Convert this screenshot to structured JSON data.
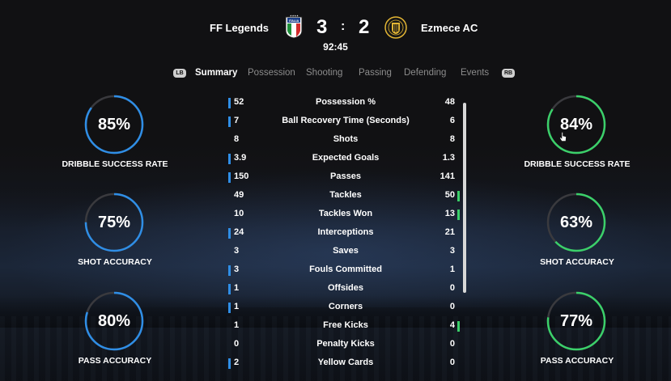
{
  "header": {
    "home_team": "FF Legends",
    "away_team": "Ezmece AC",
    "home_score": "3",
    "separator": ":",
    "away_score": "2",
    "clock": "92:45",
    "home_crest_text": "ITALIA"
  },
  "tabs": {
    "lb": "LB",
    "rb": "RB",
    "items": [
      "Summary",
      "Possession",
      "Shooting",
      "Passing",
      "Defending",
      "Events"
    ],
    "active_index": 0
  },
  "home_rings": [
    {
      "value": "85%",
      "label": "DRIBBLE SUCCESS RATE",
      "fraction": 0.85
    },
    {
      "value": "75%",
      "label": "SHOT ACCURACY",
      "fraction": 0.75
    },
    {
      "value": "80%",
      "label": "PASS ACCURACY",
      "fraction": 0.8
    }
  ],
  "away_rings": [
    {
      "value": "84%",
      "label": "DRIBBLE SUCCESS RATE",
      "fraction": 0.84
    },
    {
      "value": "63%",
      "label": "SHOT ACCURACY",
      "fraction": 0.63
    },
    {
      "value": "77%",
      "label": "PASS ACCURACY",
      "fraction": 0.77
    }
  ],
  "stats": [
    {
      "home": "52",
      "label": "Possession %",
      "away": "48",
      "leader": "home"
    },
    {
      "home": "7",
      "label": "Ball Recovery Time (Seconds)",
      "away": "6",
      "leader": "home"
    },
    {
      "home": "8",
      "label": "Shots",
      "away": "8",
      "leader": "none"
    },
    {
      "home": "3.9",
      "label": "Expected Goals",
      "away": "1.3",
      "leader": "home"
    },
    {
      "home": "150",
      "label": "Passes",
      "away": "141",
      "leader": "home"
    },
    {
      "home": "49",
      "label": "Tackles",
      "away": "50",
      "leader": "away"
    },
    {
      "home": "10",
      "label": "Tackles Won",
      "away": "13",
      "leader": "away"
    },
    {
      "home": "24",
      "label": "Interceptions",
      "away": "21",
      "leader": "home"
    },
    {
      "home": "3",
      "label": "Saves",
      "away": "3",
      "leader": "none"
    },
    {
      "home": "3",
      "label": "Fouls Committed",
      "away": "1",
      "leader": "home"
    },
    {
      "home": "1",
      "label": "Offsides",
      "away": "0",
      "leader": "home"
    },
    {
      "home": "1",
      "label": "Corners",
      "away": "0",
      "leader": "home"
    },
    {
      "home": "1",
      "label": "Free Kicks",
      "away": "4",
      "leader": "away"
    },
    {
      "home": "0",
      "label": "Penalty Kicks",
      "away": "0",
      "leader": "none"
    },
    {
      "home": "2",
      "label": "Yellow Cards",
      "away": "0",
      "leader": "home"
    }
  ],
  "colors": {
    "home_accent": "#2f8ee6",
    "away_accent": "#3bd06a",
    "ring_track": "#3a3a3e"
  }
}
